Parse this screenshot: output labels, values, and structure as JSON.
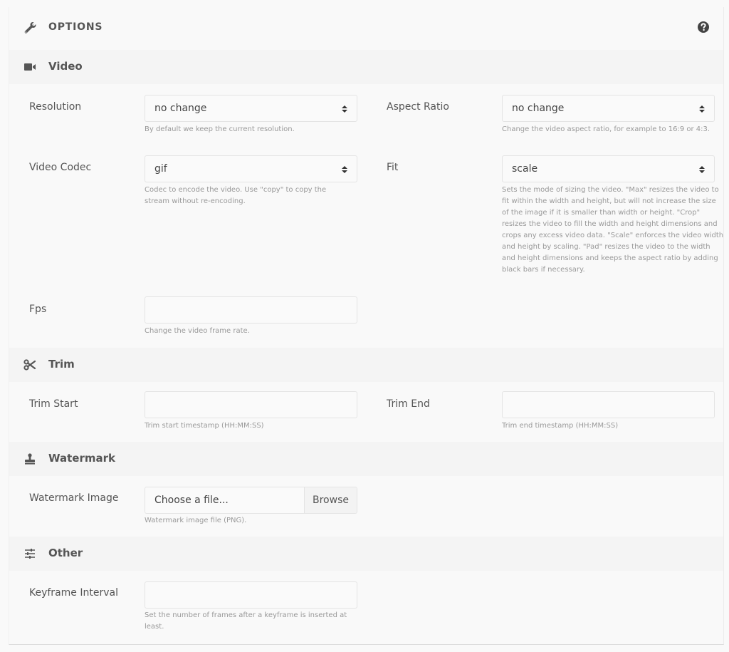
{
  "header": {
    "title": "OPTIONS",
    "icon": "wrench-icon",
    "help_icon": "question-circle-icon"
  },
  "sections": {
    "video": {
      "title": "Video",
      "icon": "video-camera-icon",
      "resolution": {
        "label": "Resolution",
        "value": "no change",
        "help": "By default we keep the current resolution."
      },
      "aspect_ratio": {
        "label": "Aspect Ratio",
        "value": "no change",
        "help": "Change the video aspect ratio, for example to 16:9 or 4:3."
      },
      "video_codec": {
        "label": "Video Codec",
        "value": "gif",
        "help": "Codec to encode the video. Use \"copy\" to copy the stream without re-encoding."
      },
      "fit": {
        "label": "Fit",
        "value": "scale",
        "help": "Sets the mode of sizing the video. \"Max\" resizes the video to fit within the width and height, but will not increase the size of the image if it is smaller than width or height. \"Crop\" resizes the video to fill the width and height dimensions and crops any excess video data. \"Scale\" enforces the video width and height by scaling. \"Pad\" resizes the video to the width and height dimensions and keeps the aspect ratio by adding black bars if necessary."
      },
      "fps": {
        "label": "Fps",
        "value": "",
        "help": "Change the video frame rate."
      }
    },
    "trim": {
      "title": "Trim",
      "icon": "scissors-icon",
      "trim_start": {
        "label": "Trim Start",
        "value": "",
        "help": "Trim start timestamp (HH:MM:SS)"
      },
      "trim_end": {
        "label": "Trim End",
        "value": "",
        "help": "Trim end timestamp (HH:MM:SS)"
      }
    },
    "watermark": {
      "title": "Watermark",
      "icon": "stamp-icon",
      "watermark_image": {
        "label": "Watermark Image",
        "placeholder": "Choose a file...",
        "browse_label": "Browse",
        "help": "Watermark image file (PNG)."
      }
    },
    "other": {
      "title": "Other",
      "icon": "sliders-icon",
      "keyframe_interval": {
        "label": "Keyframe Interval",
        "value": "",
        "help": "Set the number of frames after a keyframe is inserted at least."
      }
    }
  }
}
